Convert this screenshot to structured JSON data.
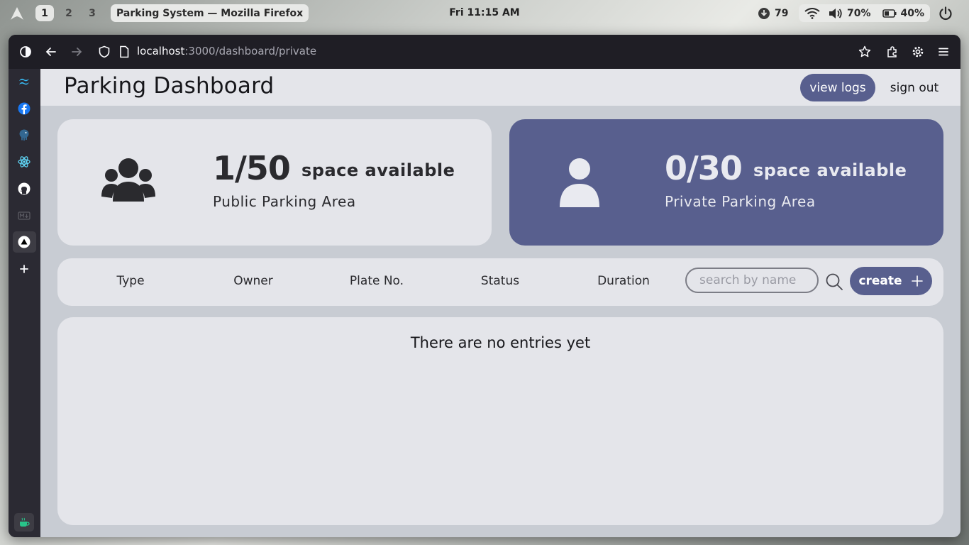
{
  "desktop": {
    "workspaces": [
      {
        "label": "1",
        "active": true
      },
      {
        "label": "2",
        "active": false
      },
      {
        "label": "3",
        "active": false
      }
    ],
    "window_title": "Parking System — Mozilla Firefox",
    "clock": "Fri 11:15 AM",
    "tray": {
      "updates": "79",
      "volume": "70%",
      "battery": "40%"
    }
  },
  "browser": {
    "url_host": "localhost",
    "url_path": ":3000/dashboard/private",
    "sidebar_icons": [
      "tailwind-icon",
      "facebook-icon",
      "postgres-icon",
      "react-icon",
      "github-icon",
      "markdown-icon",
      "vercel-icon",
      "add-icon",
      "coffee-icon"
    ]
  },
  "app": {
    "title": "Parking Dashboard",
    "view_logs_label": "view logs",
    "sign_out_label": "sign out",
    "public_card": {
      "count": "1/50",
      "availability": "space available",
      "area": "Public Parking Area"
    },
    "private_card": {
      "count": "0/30",
      "availability": "space available",
      "area": "Private Parking Area"
    },
    "columns": [
      "Type",
      "Owner",
      "Plate No.",
      "Status",
      "Duration"
    ],
    "search": {
      "placeholder": "search by name",
      "value": ""
    },
    "create_label": "create",
    "empty_message": "There are no entries yet"
  },
  "colors": {
    "accent": "#585f8e",
    "card_bg": "#e4e5ea",
    "page_bg": "#c8ccd3",
    "browser_chrome": "#1f1e25"
  }
}
